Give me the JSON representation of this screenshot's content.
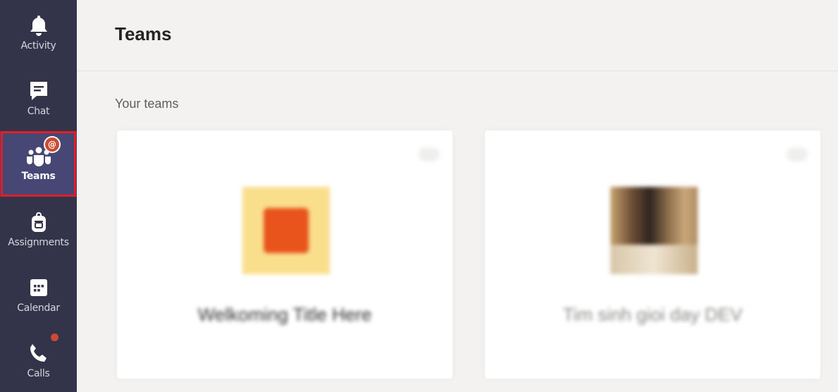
{
  "app": {
    "accent": "#464775",
    "rail_bg": "#33344a",
    "highlight": "#e21d23",
    "badge": "#cc4a31"
  },
  "rail": {
    "items": [
      {
        "label": "Activity",
        "icon": "bell-icon"
      },
      {
        "label": "Chat",
        "icon": "chat-icon"
      },
      {
        "label": "Teams",
        "icon": "teams-icon",
        "active": true,
        "badge": "@"
      },
      {
        "label": "Assignments",
        "icon": "backpack-icon"
      },
      {
        "label": "Calendar",
        "icon": "calendar-icon"
      },
      {
        "label": "Calls",
        "icon": "phone-icon",
        "dot": true
      }
    ]
  },
  "header": {
    "title": "Teams"
  },
  "main": {
    "section_label": "Your teams",
    "teams": [
      {
        "name": "Welkoming Title Here"
      },
      {
        "name": "Tim sinh gioi day DEV"
      }
    ]
  }
}
